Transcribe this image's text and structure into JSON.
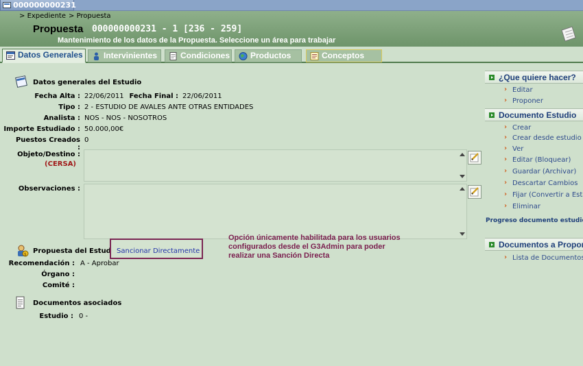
{
  "window": {
    "tab_title": "000000000231"
  },
  "breadcrumb": [
    "Expediente",
    "Propuesta"
  ],
  "header": {
    "title": "Propuesta",
    "code": "000000000231 - 1 [236 - 259]",
    "subtitle": "Mantenimiento de los datos de la Propuesta. Seleccione un área para trabajar"
  },
  "tabs": [
    {
      "label": "Datos Generales",
      "active": true
    },
    {
      "label": "Intervinientes"
    },
    {
      "label": "Condiciones"
    },
    {
      "label": "Productos"
    },
    {
      "label": "Conceptos"
    }
  ],
  "estudio": {
    "section_title": "Datos generales del Estudio",
    "fecha_alta_label": "Fecha Alta :",
    "fecha_alta": "22/06/2011",
    "fecha_final_label": "Fecha Final :",
    "fecha_final": "22/06/2011",
    "tipo_label": "Tipo :",
    "tipo": "2 - ESTUDIO DE AVALES ANTE OTRAS ENTIDADES",
    "analista_label": "Analista :",
    "analista": "NOS - NOS - NOSOTROS",
    "importe_label": "Importe Estudiado :",
    "importe": "50.000,00€",
    "puestos_label": "Puestos Creados :",
    "puestos": "0",
    "objeto_label": "Objeto/Destino :",
    "objeto_sublabel": "(CERSA)",
    "observaciones_label": "Observaciones :"
  },
  "propuesta": {
    "section_title": "Propuesta del Estudio",
    "sancionar_link": "Sancionar Directamente",
    "recomendacion_label": "Recomendación :",
    "recomendacion": "A - Aprobar",
    "organo_label": "Órgano :",
    "comite_label": "Comité :"
  },
  "callout": {
    "lines": [
      "Opción únicamente habilitada para los usuarios",
      "configurados desde el G3Admin para poder",
      "realizar una Sanción Directa"
    ],
    "color": "#7a1e4e"
  },
  "documentos": {
    "section_title": "Documentos asociados",
    "estudio_label": "Estudio :",
    "estudio": "0 -"
  },
  "right_panel": {
    "que_hacer": {
      "title": "¿Que quiere hacer?",
      "items": [
        "Editar",
        "Proponer"
      ]
    },
    "doc_estudio": {
      "title": "Documento Estudio",
      "items": [
        "Crear",
        "Crear desde estudio anterior",
        "Ver",
        "Editar (Bloquear)",
        "Guardar (Archivar)",
        "Descartar Cambios",
        "Fijar (Convertir a Estático)",
        "Eliminar"
      ]
    },
    "progreso": "Progreso documento estudio ...",
    "doc_proponer": {
      "title": "Documentos a Proponer",
      "items": [
        "Lista de Documentos"
      ]
    }
  }
}
